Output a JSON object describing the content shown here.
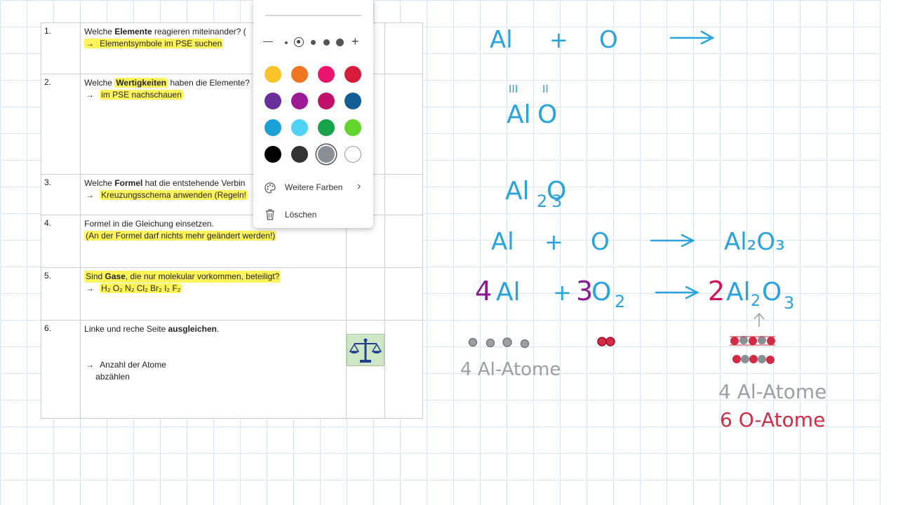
{
  "steps": [
    {
      "num": "1.",
      "l1_pre": "Welche ",
      "l1_bold": "Elemente",
      "l1_post": " reagieren miteinander? (",
      "l2": "Elementsymbole im PSE suchen"
    },
    {
      "num": "2.",
      "l1_pre": "Welche ",
      "l1_bold": "Wertigkeiten",
      "l1_post": " haben die Elemente?",
      "l2": "im PSE nachschauen"
    },
    {
      "num": "3.",
      "l1_pre": "Welche ",
      "l1_bold": "Formel",
      "l1_post": " hat die entstehende Verbin",
      "l2": "Kreuzungsschema anwenden (Regeln!"
    },
    {
      "num": "4.",
      "l1": "Formel in die Gleichung einsetzen.",
      "l2": "(An der Formel darf nichts mehr geändert werden!)"
    },
    {
      "num": "5.",
      "l1_pre": "Sind ",
      "l1_bold": "Gase",
      "l1_post": ", die nur molekular vorkommen, beteiligt?",
      "l2": "H₂ O₂ N₂ Cl₂ Br₂ I₂ F₂"
    },
    {
      "num": "6.",
      "l1_pre": "Linke und reche Seite ",
      "l1_bold": "ausgleichen",
      "l1_post": ".",
      "l2": "Anzahl der Atome",
      "l3": "abzählen"
    }
  ],
  "arrow_glyph": "→",
  "pen_menu": {
    "colors": [
      "#f9c32a",
      "#f07624",
      "#e8166f",
      "#d81a3a",
      "#6a2e9b",
      "#9c1a94",
      "#c0126a",
      "#125f96",
      "#1aa2d6",
      "#4fd3f5",
      "#16a34a",
      "#62d42a",
      "#000000",
      "#333333",
      "#8a8f93",
      "#ffffff"
    ],
    "more_colors": "Weitere Farben",
    "delete": "Löschen",
    "minus_glyph": "—",
    "plus_glyph": "+",
    "chevron_glyph": "›"
  },
  "ink": {
    "eq1_al": "Al",
    "eq1_plus": "+",
    "eq1_o": "O",
    "val_al": "III",
    "val_o": "II",
    "val_al_sym": "Al",
    "val_o_sym": "O",
    "formula_al": "Al",
    "formula_2": "2",
    "formula_o": "O",
    "formula_3": "3",
    "eq2_al": "Al",
    "eq2_plus": "+",
    "eq2_o": "O",
    "eq2_prod": "Al₂O₃",
    "eq3_4": "4",
    "eq3_al": "Al",
    "eq3_plus": "+",
    "eq3_3": "3",
    "eq3_o": "O",
    "eq3_sub2": "2",
    "eq3_2": "2",
    "eq3_prod_al": "Al",
    "eq3_prod_2": "2",
    "eq3_prod_o": "O",
    "eq3_prod_3": "3",
    "left_count": "4  Al-Atome",
    "right_al_count": "4  Al-Atome",
    "right_o_count": "6  O-Atome"
  },
  "colors": {
    "ink_blue": "#2aa3dc",
    "ink_purple": "#8b1a8f",
    "ink_magenta": "#d1145a",
    "ink_red": "#d22b45",
    "ink_gray": "#8a8f93"
  }
}
